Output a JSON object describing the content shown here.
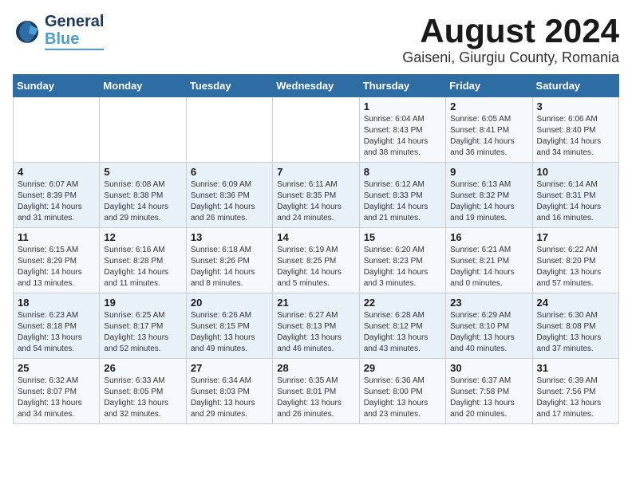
{
  "logo": {
    "line1": "General",
    "line2": "Blue"
  },
  "header": {
    "month": "August 2024",
    "location": "Gaiseni, Giurgiu County, Romania"
  },
  "weekdays": [
    "Sunday",
    "Monday",
    "Tuesday",
    "Wednesday",
    "Thursday",
    "Friday",
    "Saturday"
  ],
  "weeks": [
    [
      {
        "day": "",
        "info": ""
      },
      {
        "day": "",
        "info": ""
      },
      {
        "day": "",
        "info": ""
      },
      {
        "day": "",
        "info": ""
      },
      {
        "day": "1",
        "info": "Sunrise: 6:04 AM\nSunset: 8:43 PM\nDaylight: 14 hours\nand 38 minutes."
      },
      {
        "day": "2",
        "info": "Sunrise: 6:05 AM\nSunset: 8:41 PM\nDaylight: 14 hours\nand 36 minutes."
      },
      {
        "day": "3",
        "info": "Sunrise: 6:06 AM\nSunset: 8:40 PM\nDaylight: 14 hours\nand 34 minutes."
      }
    ],
    [
      {
        "day": "4",
        "info": "Sunrise: 6:07 AM\nSunset: 8:39 PM\nDaylight: 14 hours\nand 31 minutes."
      },
      {
        "day": "5",
        "info": "Sunrise: 6:08 AM\nSunset: 8:38 PM\nDaylight: 14 hours\nand 29 minutes."
      },
      {
        "day": "6",
        "info": "Sunrise: 6:09 AM\nSunset: 8:36 PM\nDaylight: 14 hours\nand 26 minutes."
      },
      {
        "day": "7",
        "info": "Sunrise: 6:11 AM\nSunset: 8:35 PM\nDaylight: 14 hours\nand 24 minutes."
      },
      {
        "day": "8",
        "info": "Sunrise: 6:12 AM\nSunset: 8:33 PM\nDaylight: 14 hours\nand 21 minutes."
      },
      {
        "day": "9",
        "info": "Sunrise: 6:13 AM\nSunset: 8:32 PM\nDaylight: 14 hours\nand 19 minutes."
      },
      {
        "day": "10",
        "info": "Sunrise: 6:14 AM\nSunset: 8:31 PM\nDaylight: 14 hours\nand 16 minutes."
      }
    ],
    [
      {
        "day": "11",
        "info": "Sunrise: 6:15 AM\nSunset: 8:29 PM\nDaylight: 14 hours\nand 13 minutes."
      },
      {
        "day": "12",
        "info": "Sunrise: 6:16 AM\nSunset: 8:28 PM\nDaylight: 14 hours\nand 11 minutes."
      },
      {
        "day": "13",
        "info": "Sunrise: 6:18 AM\nSunset: 8:26 PM\nDaylight: 14 hours\nand 8 minutes."
      },
      {
        "day": "14",
        "info": "Sunrise: 6:19 AM\nSunset: 8:25 PM\nDaylight: 14 hours\nand 5 minutes."
      },
      {
        "day": "15",
        "info": "Sunrise: 6:20 AM\nSunset: 8:23 PM\nDaylight: 14 hours\nand 3 minutes."
      },
      {
        "day": "16",
        "info": "Sunrise: 6:21 AM\nSunset: 8:21 PM\nDaylight: 14 hours\nand 0 minutes."
      },
      {
        "day": "17",
        "info": "Sunrise: 6:22 AM\nSunset: 8:20 PM\nDaylight: 13 hours\nand 57 minutes."
      }
    ],
    [
      {
        "day": "18",
        "info": "Sunrise: 6:23 AM\nSunset: 8:18 PM\nDaylight: 13 hours\nand 54 minutes."
      },
      {
        "day": "19",
        "info": "Sunrise: 6:25 AM\nSunset: 8:17 PM\nDaylight: 13 hours\nand 52 minutes."
      },
      {
        "day": "20",
        "info": "Sunrise: 6:26 AM\nSunset: 8:15 PM\nDaylight: 13 hours\nand 49 minutes."
      },
      {
        "day": "21",
        "info": "Sunrise: 6:27 AM\nSunset: 8:13 PM\nDaylight: 13 hours\nand 46 minutes."
      },
      {
        "day": "22",
        "info": "Sunrise: 6:28 AM\nSunset: 8:12 PM\nDaylight: 13 hours\nand 43 minutes."
      },
      {
        "day": "23",
        "info": "Sunrise: 6:29 AM\nSunset: 8:10 PM\nDaylight: 13 hours\nand 40 minutes."
      },
      {
        "day": "24",
        "info": "Sunrise: 6:30 AM\nSunset: 8:08 PM\nDaylight: 13 hours\nand 37 minutes."
      }
    ],
    [
      {
        "day": "25",
        "info": "Sunrise: 6:32 AM\nSunset: 8:07 PM\nDaylight: 13 hours\nand 34 minutes."
      },
      {
        "day": "26",
        "info": "Sunrise: 6:33 AM\nSunset: 8:05 PM\nDaylight: 13 hours\nand 32 minutes."
      },
      {
        "day": "27",
        "info": "Sunrise: 6:34 AM\nSunset: 8:03 PM\nDaylight: 13 hours\nand 29 minutes."
      },
      {
        "day": "28",
        "info": "Sunrise: 6:35 AM\nSunset: 8:01 PM\nDaylight: 13 hours\nand 26 minutes."
      },
      {
        "day": "29",
        "info": "Sunrise: 6:36 AM\nSunset: 8:00 PM\nDaylight: 13 hours\nand 23 minutes."
      },
      {
        "day": "30",
        "info": "Sunrise: 6:37 AM\nSunset: 7:58 PM\nDaylight: 13 hours\nand 20 minutes."
      },
      {
        "day": "31",
        "info": "Sunrise: 6:39 AM\nSunset: 7:56 PM\nDaylight: 13 hours\nand 17 minutes."
      }
    ]
  ]
}
